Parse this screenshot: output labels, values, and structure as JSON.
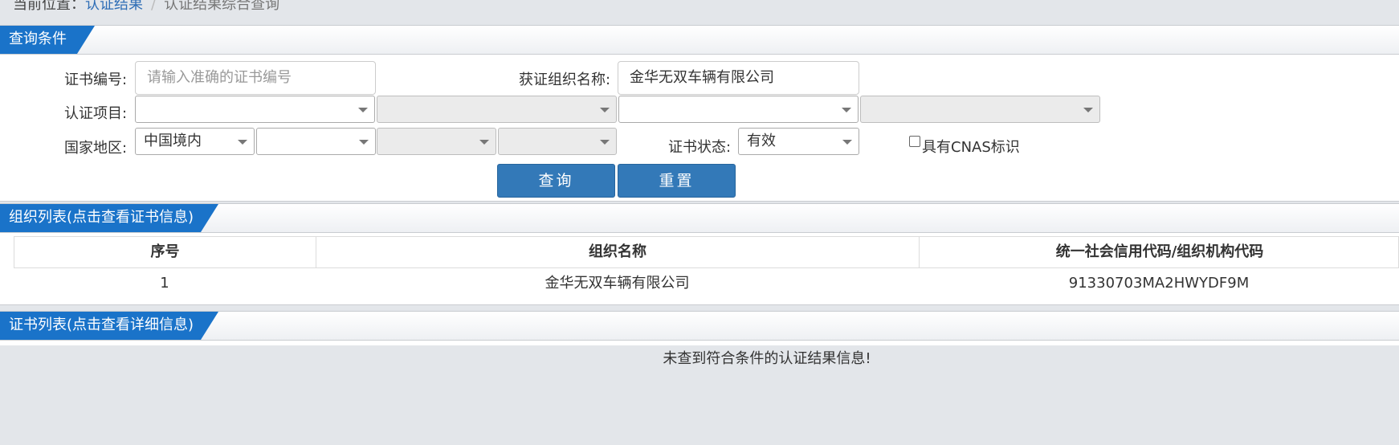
{
  "breadcrumb": {
    "prefix": "当前位置：",
    "link": "认证结果",
    "separator": "/",
    "current": "认证结果综合查询"
  },
  "query_panel": {
    "title": "查询条件",
    "cert_no": {
      "label": "证书编号:",
      "value": "",
      "placeholder": "请输入准确的证书编号"
    },
    "org_name": {
      "label": "获证组织名称:",
      "value": "金华无双车辆有限公司"
    },
    "project": {
      "label": "认证项目:",
      "selects": [
        "",
        "",
        "",
        ""
      ]
    },
    "region": {
      "label": "国家地区:",
      "selects": [
        "中国境内",
        "",
        "",
        ""
      ]
    },
    "status": {
      "label": "证书状态:",
      "value": "有效"
    },
    "cnas": {
      "label": "具有CNAS标识",
      "checked": false
    },
    "buttons": {
      "query": "查询",
      "reset": "重置"
    }
  },
  "org_panel": {
    "title": "组织列表(点击查看证书信息)",
    "columns": [
      "序号",
      "组织名称",
      "统一社会信用代码/组织机构代码"
    ],
    "rows": [
      {
        "no": "1",
        "name": "金华无双车辆有限公司",
        "code": "91330703MA2HWYDF9M"
      }
    ]
  },
  "cert_panel": {
    "title": "证书列表(点击查看详细信息)",
    "empty_message": "未查到符合条件的认证结果信息!"
  }
}
